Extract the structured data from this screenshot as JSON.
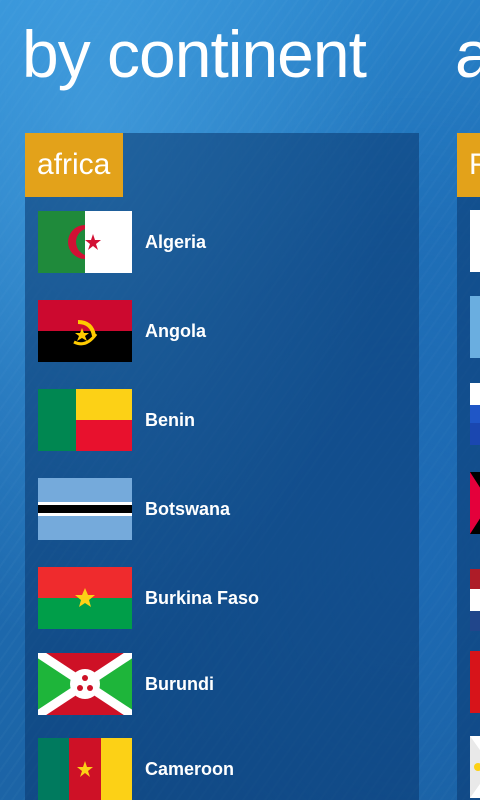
{
  "header": {
    "title": "by continent",
    "next_title_fragment": "a"
  },
  "section": {
    "label": "africa",
    "countries": [
      {
        "name": "Algeria",
        "flag": "algeria-flag-icon"
      },
      {
        "name": "Angola",
        "flag": "angola-flag-icon"
      },
      {
        "name": "Benin",
        "flag": "benin-flag-icon"
      },
      {
        "name": "Botswana",
        "flag": "botswana-flag-icon"
      },
      {
        "name": "Burkina Faso",
        "flag": "burkina-faso-flag-icon"
      },
      {
        "name": "Burundi",
        "flag": "burundi-flag-icon"
      },
      {
        "name": "Cameroon",
        "flag": "cameroon-flag-icon"
      }
    ]
  },
  "next_section": {
    "label_fragment": "F"
  },
  "colors": {
    "accent": "#e3a21a",
    "background": "#1f6fb6",
    "panel": "#0a376e"
  }
}
